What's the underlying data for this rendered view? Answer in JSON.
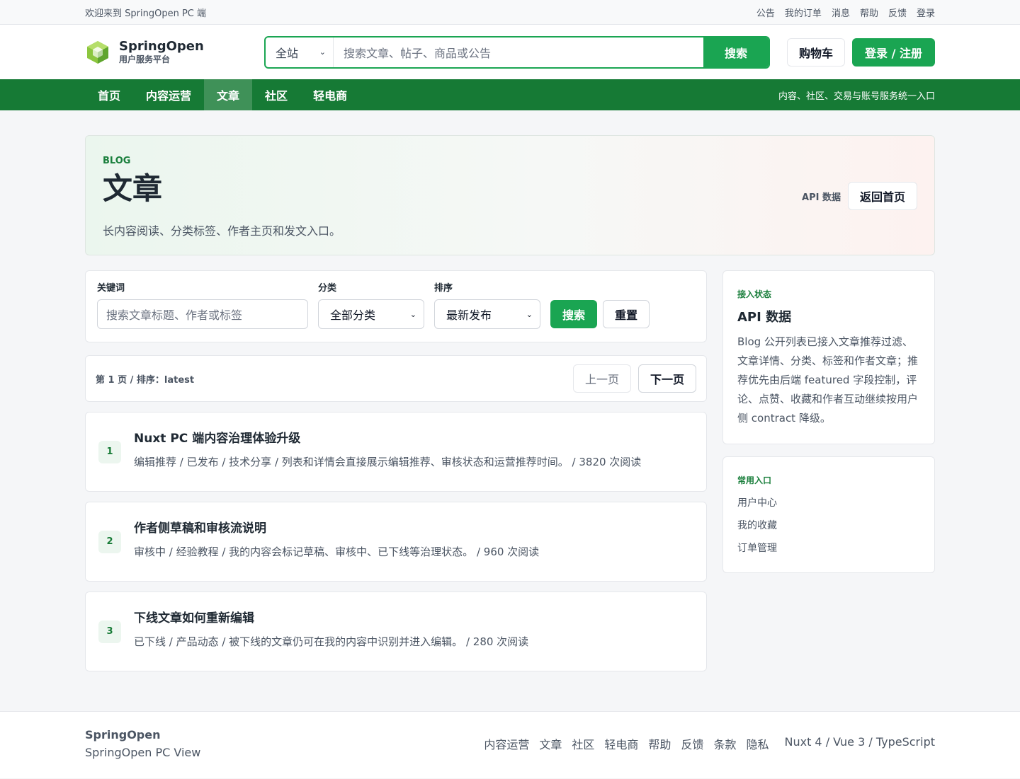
{
  "topbar": {
    "welcome": "欢迎来到 SpringOpen PC 端",
    "links": [
      "公告",
      "我的订单",
      "消息",
      "帮助",
      "反馈",
      "登录"
    ]
  },
  "header": {
    "brand_name": "SpringOpen",
    "brand_sub": "用户服务平台",
    "search_scope": "全站",
    "search_placeholder": "搜索文章、帖子、商品或公告",
    "search_button": "搜索",
    "cart": "购物车",
    "login": "登录 / 注册"
  },
  "nav": {
    "items": [
      "首页",
      "内容运营",
      "文章",
      "社区",
      "轻电商"
    ],
    "active": "文章",
    "tagline": "内容、社区、交易与账号服务统一入口"
  },
  "hero": {
    "eyebrow": "BLOG",
    "title": "文章",
    "desc": "长内容阅读、分类标签、作者主页和发文入口。",
    "api_label": "API 数据",
    "back": "返回首页"
  },
  "filters": {
    "keyword_label": "关键词",
    "keyword_placeholder": "搜索文章标题、作者或标签",
    "category_label": "分类",
    "category_value": "全部分类",
    "sort_label": "排序",
    "sort_value": "最新发布",
    "search": "搜索",
    "reset": "重置"
  },
  "pager": {
    "info": "第 1 页 / 排序：latest",
    "prev": "上一页",
    "next": "下一页"
  },
  "articles": [
    {
      "num": "1",
      "title": "Nuxt PC 端内容治理体验升级",
      "meta": "编辑推荐 / 已发布 / 技术分享 / 列表和详情会直接展示编辑推荐、审核状态和运营推荐时间。 / 3820 次阅读"
    },
    {
      "num": "2",
      "title": "作者侧草稿和审核流说明",
      "meta": "审核中 / 经验教程 / 我的内容会标记草稿、审核中、已下线等治理状态。 / 960 次阅读"
    },
    {
      "num": "3",
      "title": "下线文章如何重新编辑",
      "meta": "已下线 / 产品动态 / 被下线的文章仍可在我的内容中识别并进入编辑。 / 280 次阅读"
    }
  ],
  "status": {
    "eyebrow": "接入状态",
    "title": "API 数据",
    "text": "Blog 公开列表已接入文章推荐过滤、文章详情、分类、标签和作者文章；推荐优先由后端 featured 字段控制，评论、点赞、收藏和作者互动继续按用户侧 contract 降级。"
  },
  "quick": {
    "eyebrow": "常用入口",
    "items": [
      "用户中心",
      "我的收藏",
      "订单管理"
    ]
  },
  "footer": {
    "brand": "SpringOpen",
    "sub": "SpringOpen PC View",
    "links": [
      "内容运营",
      "文章",
      "社区",
      "轻电商",
      "帮助",
      "反馈",
      "条款",
      "隐私"
    ],
    "stack": "Nuxt 4 / Vue 3 / TypeScript"
  },
  "colors": {
    "brand_green": "#1aa552",
    "nav_green": "#167a35"
  }
}
